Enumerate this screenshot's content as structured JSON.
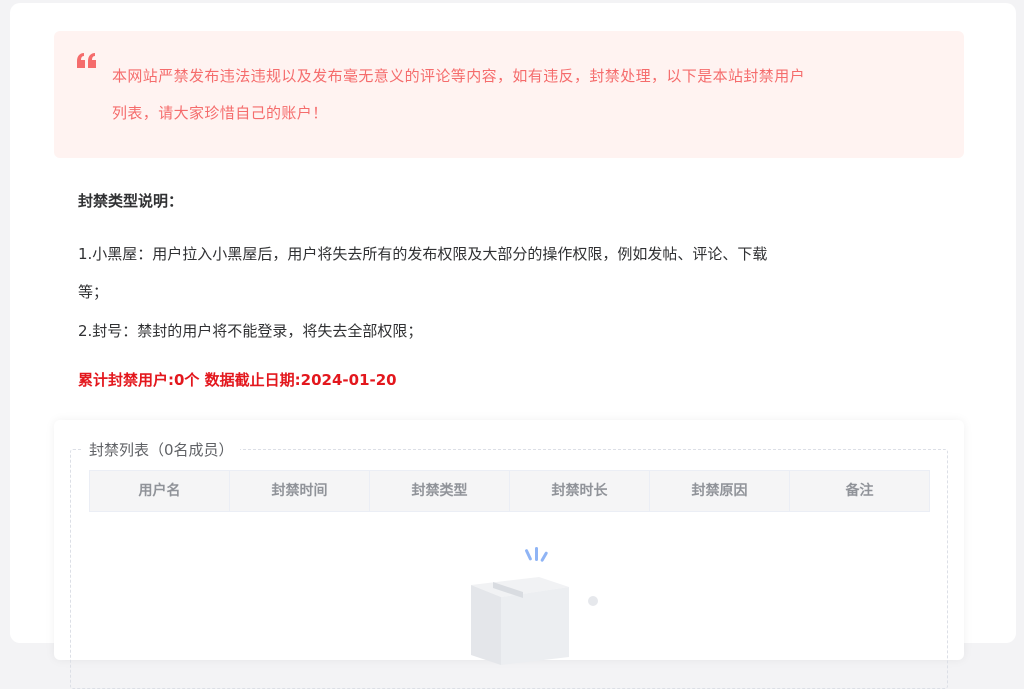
{
  "notice": {
    "icon": "quote-icon",
    "line1": "本网站严禁发布违法违规以及发布毫无意义的评论等内容，如有违反，封禁处理，以下是本站封禁用户",
    "line2": "列表，请大家珍惜自己的账户！"
  },
  "ban_types": {
    "heading": "封禁类型说明：",
    "rule1_line1": "1.小黑屋：用户拉入小黑屋后，用户将失去所有的发布权限及大部分的操作权限，例如发帖、评论、下载",
    "rule1_line2": "等；",
    "rule2": "2.封号：禁封的用户将不能登录，将失去全部权限；"
  },
  "stats": {
    "text": "累计封禁用户:0个 数据截止日期:2024-01-20"
  },
  "ban_list": {
    "legend": "封禁列表（0名成员）",
    "columns": [
      "用户名",
      "封禁时间",
      "封禁类型",
      "封禁时长",
      "封禁原因",
      "备注"
    ],
    "rows": [],
    "empty_icon": "empty-box-icon"
  },
  "colors": {
    "notice_bg": "#fff3f1",
    "notice_text": "#f56c6c",
    "stats_text": "#e3171d"
  }
}
